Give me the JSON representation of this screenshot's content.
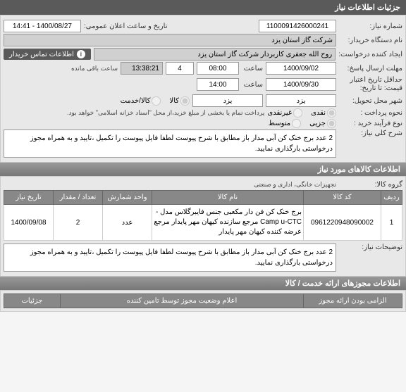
{
  "headers": {
    "main": "جزئیات اطلاعات نیاز",
    "items_info": "اطلاعات کالاهای مورد نیاز",
    "permits": "اطلاعات مجوزهای ارائه خدمت / کالا"
  },
  "labels": {
    "need_no": "شماره نیاز:",
    "announce_dt": "تاریخ و ساعت اعلان عمومی:",
    "buyer": "نام دستگاه خریدار:",
    "requester": "ایجاد کننده درخواست:",
    "contact": "اطلاعات تماس خریدار",
    "deadline": "مهلت ارسال پاسخ:",
    "time": "ساعت",
    "min_validity": "حداقل تاریخ اعتبار",
    "price_until": "قیمت: تا تاریخ:",
    "delivery_city": "شهر محل تحویل:",
    "payment_label": "نحوه پرداخت :",
    "payment_note": "پرداخت تمام یا بخشی از مبلغ خرید،از محل \"اسناد خزانه اسلامی\" خواهد بود.",
    "process_type": "نوع فرآیند خرید :",
    "need_desc": "شرح کلی نیاز:",
    "goods_group": "گروه کالا:",
    "after_desc": "توضیحات نیاز:",
    "remain": "ساعت باقی مانده"
  },
  "fields": {
    "need_no": "1100091426000241",
    "announce_dt": "1400/08/27 - 14:41",
    "buyer": "شرکت گاز استان یزد",
    "requester": "روح الله جعفری کاربردار شرکت گاز استان یزد",
    "deadline_date": "1400/09/02",
    "deadline_time": "08:00",
    "deadline_days": "4",
    "remain_time": "13:38:21",
    "validity_date": "1400/09/30",
    "validity_time": "14:00",
    "delivery_city": "یزد",
    "delivery_city2": "یزد",
    "need_desc": "2 عدد برج خنک کن آبی مدار باز مطابق با شرح پیوست لطفا فایل پیوست را تکمیل ،تایید و به همراه مجوز درخواستی بارگذاری نمایید.",
    "goods_group": "تجهیزات خانگی، اداری و صنعتی",
    "after_desc": "2 عدد برج خنک کن آبی مدار باز مطابق با شرح پیوست لطفا فایل پیوست را تکمیل ،تایید و به همراه مجوز درخواستی بارگذاری نمایید."
  },
  "radios": {
    "payment": {
      "cash": "نقدی",
      "non_cash": "غیرنقدی"
    },
    "delivery_type": {
      "goods": "کالا",
      "service": "کالا/خدمت"
    },
    "process": {
      "partial": "جزیی",
      "mid": "متوسط"
    }
  },
  "table": {
    "cols": {
      "row": "ردیف",
      "code": "کد کالا",
      "name": "نام کالا",
      "unit": "واحد شمارش",
      "qty": "تعداد / مقدار",
      "date": "تاریخ نیاز"
    },
    "rows": [
      {
        "row": "1",
        "code": "0961220948090002",
        "name": "برج خنک کن فن دار مکعبی جنس فایبرگلاس مدل -Camp u-CTC مرجع سازنده کیهان مهر پایدار مرجع عرضه کننده کیهان مهر پایدار",
        "unit": "عدد",
        "qty": "2",
        "date": "1400/09/08"
      }
    ]
  },
  "bottom_table": {
    "cols": {
      "mandatory": "الزامی بودن ارائه مجوز",
      "status": "اعلام وضعیت مجوز توسط تامین کننده",
      "details": "جزئیات"
    }
  }
}
